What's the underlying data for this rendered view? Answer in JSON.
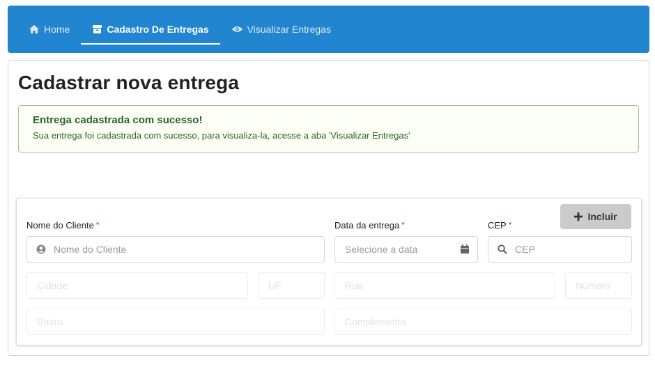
{
  "nav": {
    "items": [
      {
        "label": "Home",
        "icon": "home-icon"
      },
      {
        "label": "Cadastro De Entregas",
        "icon": "box-icon",
        "active": true
      },
      {
        "label": "Visualizar Entregas",
        "icon": "eye-icon"
      }
    ]
  },
  "page": {
    "title": "Cadastrar nova entrega"
  },
  "alert": {
    "title": "Entrega cadastrada com sucesso!",
    "text": "Sua entrega foi cadastrada com sucesso, para visualiza-la, acesse a aba 'Visualizar Entregas'"
  },
  "form": {
    "include_label": "Incluir",
    "required_mark": "*",
    "cliente": {
      "label": "Nome do Cliente",
      "placeholder": "Nome do Cliente",
      "value": ""
    },
    "data": {
      "label": "Data da entrega",
      "placeholder": "Selecione a data",
      "value": ""
    },
    "cep": {
      "label": "CEP",
      "placeholder": "CEP",
      "value": ""
    },
    "cidade": {
      "placeholder": "Cidade"
    },
    "uf": {
      "placeholder": "UF"
    },
    "rua": {
      "placeholder": "Rua"
    },
    "numero": {
      "placeholder": "Número"
    },
    "bairro": {
      "placeholder": "Bairro"
    },
    "complemento": {
      "placeholder": "Complemento"
    }
  },
  "colors": {
    "navbar": "#2185d0",
    "alert_bg": "#fcfff5",
    "alert_text": "#2c662d",
    "required": "#db2828",
    "button": "#cbcbcb"
  }
}
